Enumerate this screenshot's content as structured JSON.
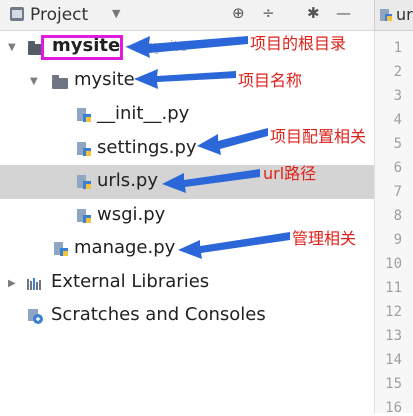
{
  "toolbar": {
    "title": "Project",
    "caret": "▼",
    "buttons": [
      {
        "icon": "target-icon",
        "glyph": "⊕"
      },
      {
        "icon": "collapse-all-icon",
        "glyph": "÷"
      },
      {
        "icon": "gear-icon",
        "glyph": "✱"
      },
      {
        "icon": "minimize-icon",
        "glyph": "—"
      }
    ]
  },
  "editor_tab": {
    "label": "ur"
  },
  "tree": {
    "root": {
      "label": "mysite",
      "path_hint": "~/mysite"
    },
    "package": {
      "label": "mysite"
    },
    "files": [
      "__init__.py",
      "settings.py",
      "urls.py",
      "wsgi.py"
    ],
    "manage": "manage.py",
    "external": "External Libraries",
    "scratches": "Scratches and Consoles"
  },
  "line_numbers": [
    "1",
    "2",
    "3",
    "4",
    "5",
    "6",
    "7",
    "8",
    "9",
    "10",
    "11",
    "12",
    "13",
    "14",
    "15",
    "16"
  ],
  "annotations": {
    "root_note": "项目的根目录",
    "package_note": "项目名称",
    "settings_note": "项目配置相关",
    "urls_note": "url路径",
    "manage_note": "管理相关"
  },
  "colors": {
    "annotation": "#e0211a",
    "arrow": "#2b67d8",
    "highlight_box": "#e01ae0",
    "selected_row": "#d4d4d4"
  }
}
